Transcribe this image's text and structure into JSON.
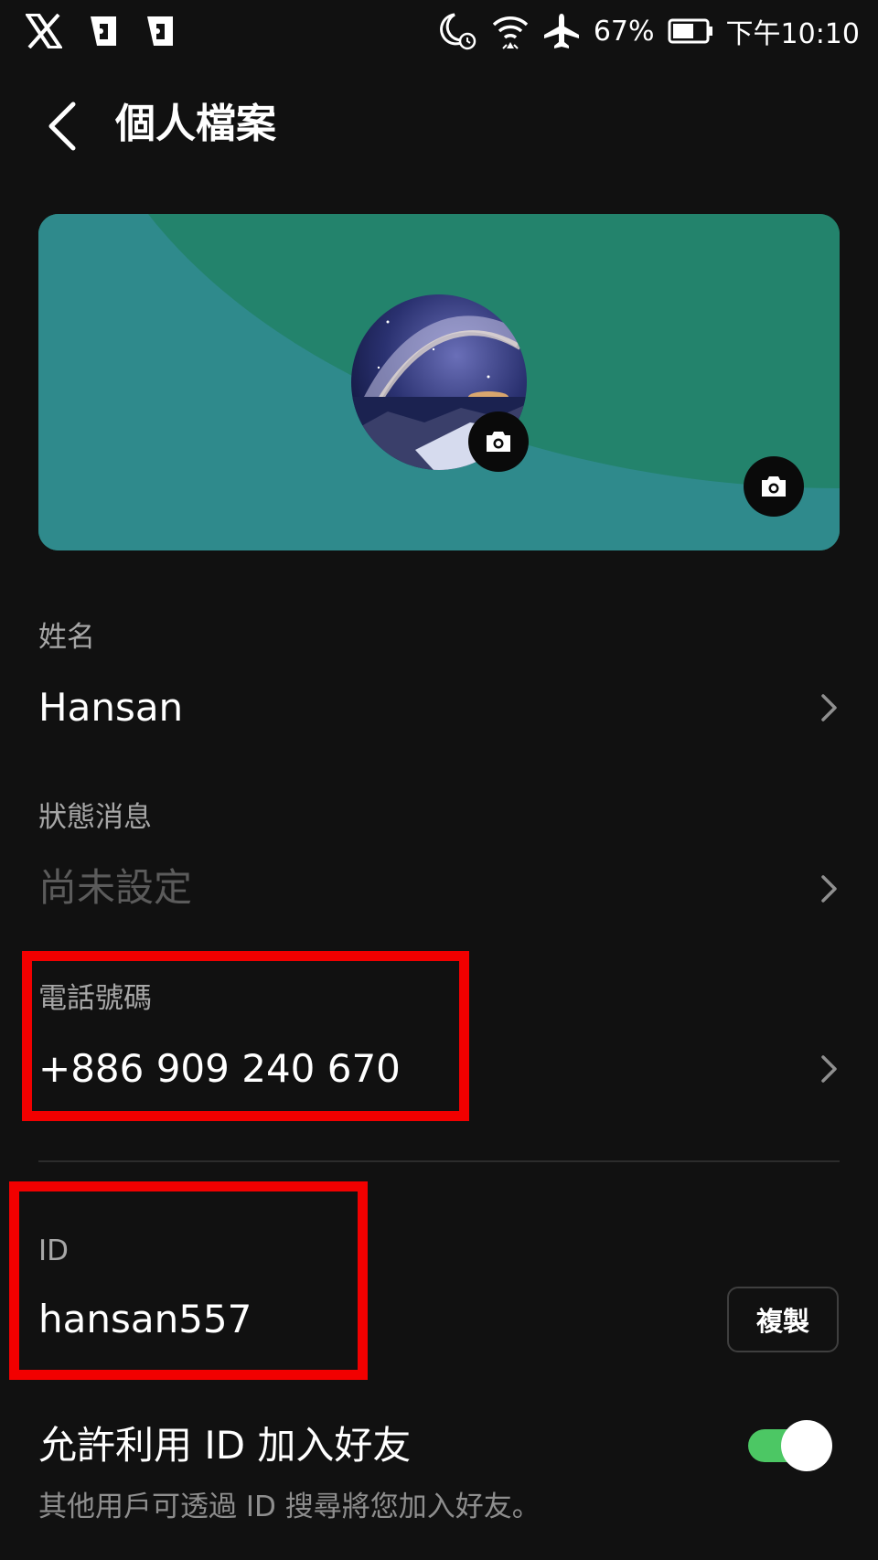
{
  "status_bar": {
    "battery": "67%",
    "time": "下午10:10",
    "icons": [
      "x-logo-icon",
      "notification-app-icon",
      "notification-app-icon",
      "moon-alarm-icon",
      "wifi-icon",
      "airplane-mode-icon",
      "battery-icon"
    ]
  },
  "header": {
    "title": "個人檔案"
  },
  "profile": {
    "name_label": "姓名",
    "name_value": "Hansan",
    "status_label": "狀態消息",
    "status_value": "尚未設定",
    "phone_label": "電話號碼",
    "phone_value": "+886 909 240 670",
    "id_label": "ID",
    "id_value": "hansan557",
    "copy_button": "複製",
    "allow_id_label": "允許利用 ID 加入好友",
    "allow_id_desc": "其他用戶可透過 ID 搜尋將您加入好友。",
    "allow_id_enabled": true
  },
  "colors": {
    "background": "#111111",
    "cover_primary": "#23836c",
    "cover_secondary": "#2f8a8c",
    "toggle_on": "#4cc764",
    "highlight_box": "#f20000"
  }
}
